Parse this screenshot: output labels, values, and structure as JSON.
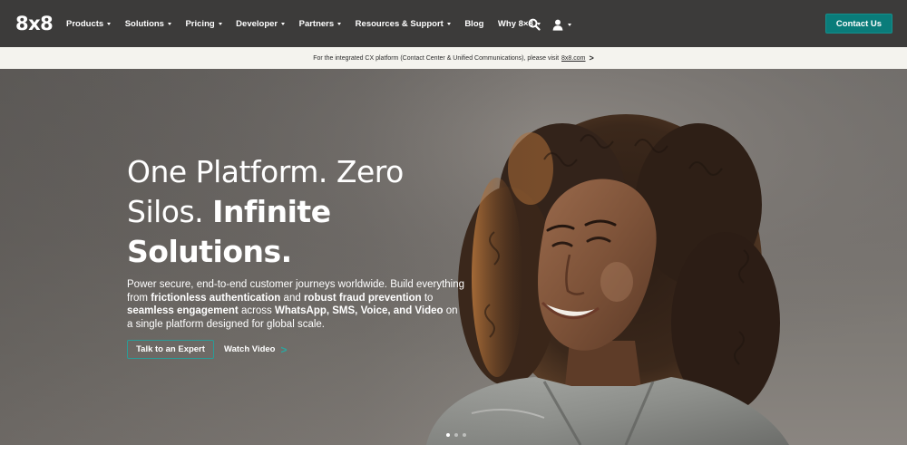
{
  "brand": {
    "logo_text": "8x8",
    "accent_color": "#0a7c7a"
  },
  "nav": {
    "items": [
      {
        "label": "Products",
        "has_dropdown": true
      },
      {
        "label": "Solutions",
        "has_dropdown": true
      },
      {
        "label": "Pricing",
        "has_dropdown": true
      },
      {
        "label": "Developer",
        "has_dropdown": true
      },
      {
        "label": "Partners",
        "has_dropdown": true
      },
      {
        "label": "Resources & Support",
        "has_dropdown": true
      },
      {
        "label": "Blog",
        "has_dropdown": false
      },
      {
        "label": "Why 8×8",
        "has_dropdown": true
      }
    ],
    "search_icon": "search-icon",
    "user_icon": "user-icon",
    "contact_label": "Contact Us"
  },
  "announcement": {
    "text": "For the integrated CX platform (Contact Center & Unified Communications), please visit",
    "link_text": "8x8.com",
    "chevron": ">"
  },
  "hero": {
    "headline_line1": "One Platform. Zero",
    "headline_line2_regular": "Silos.",
    "headline_line2_bold": "Infinite",
    "headline_line3_bold": "Solutions.",
    "sub_1": "Power secure, end-to-end customer journeys worldwide. Build everything from",
    "sub_2_bold": "frictionless authentication",
    "sub_3": "and",
    "sub_4_bold": "robust fraud prevention",
    "sub_5": "to",
    "sub_6_bold": "seamless engagement",
    "sub_7": "across",
    "sub_8_bold": "WhatsApp, SMS, Voice, and Video",
    "sub_9": "on a single platform designed for global scale.",
    "cta_primary": "Talk to an Expert",
    "cta_secondary": "Watch Video",
    "cta_secondary_chevron": ">",
    "slides_total": 3,
    "slide_active": 1
  }
}
